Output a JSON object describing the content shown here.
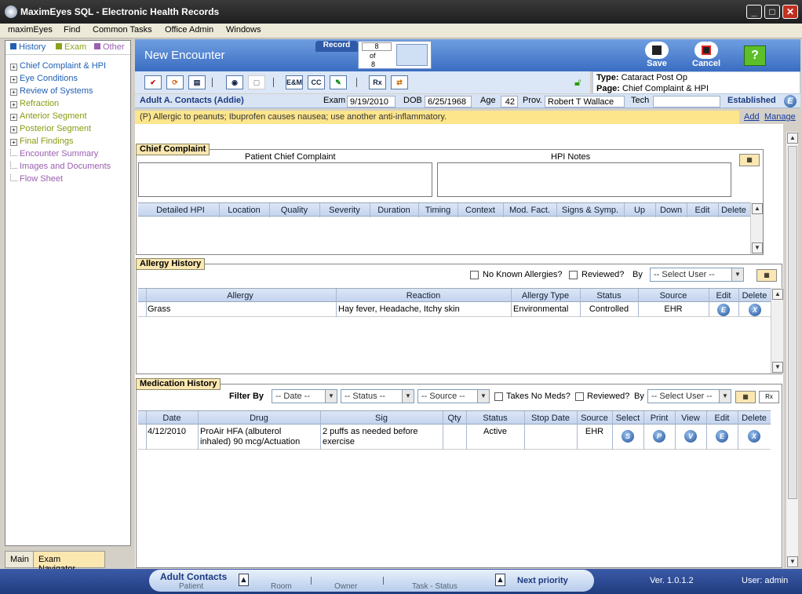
{
  "window": {
    "title": "MaximEyes SQL - Electronic Health Records"
  },
  "menu": [
    "maximEyes",
    "Find",
    "Common Tasks",
    "Office Admin",
    "Windows"
  ],
  "nav": {
    "legend": [
      {
        "label": "History",
        "color": "#1f5fb4"
      },
      {
        "label": "Exam",
        "color": "#8aa21a"
      },
      {
        "label": "Other",
        "color": "#9a5fb0"
      }
    ],
    "items": [
      {
        "label": "Chief Complaint & HPI",
        "color": "#1f5fb4"
      },
      {
        "label": "Eye Conditions",
        "color": "#1f5fb4"
      },
      {
        "label": "Review of Systems",
        "color": "#1f5fb4"
      },
      {
        "label": "Refraction",
        "color": "#8a9a10"
      },
      {
        "label": "Anterior Segment",
        "color": "#8a9a10"
      },
      {
        "label": "Posterior Segment",
        "color": "#8a9a10"
      },
      {
        "label": "Final Findings",
        "color": "#8a9a10"
      },
      {
        "label": "Encounter Summary",
        "color": "#9a5fb0"
      },
      {
        "label": "Images and Documents",
        "color": "#9a5fb0"
      },
      {
        "label": "Flow Sheet",
        "color": "#9a5fb0"
      }
    ],
    "tabs": {
      "main": "Main",
      "navigator": "Exam Navigator"
    }
  },
  "header": {
    "title": "New Encounter",
    "record_label": "Record",
    "record_current": "8",
    "record_of": "of",
    "record_total": "8",
    "save_label": "Save",
    "cancel_label": "Cancel"
  },
  "toolbar": {
    "em": "E&M",
    "cc": "CC",
    "rx": "Rx"
  },
  "type": {
    "type_label": "Type:",
    "type_value": "Cataract Post Op",
    "page_label": "Page:",
    "page_value": "Chief Complaint & HPI"
  },
  "patient": {
    "name": "Adult A. Contacts (Addie)",
    "exam_label": "Exam",
    "exam": "9/19/2010",
    "dob_label": "DOB",
    "dob": "6/25/1968",
    "age_label": "Age",
    "age": "42",
    "prov_label": "Prov.",
    "prov": "Robert T Wallace",
    "tech_label": "Tech",
    "tech": "",
    "status": "Established"
  },
  "alert": {
    "text": "(P) Allergic to peanuts; Ibuprofen causes nausea; use another anti-inflammatory.",
    "add": "Add",
    "manage": "Manage"
  },
  "chief": {
    "section_title": "Chief Complaint",
    "patient_label": "Patient Chief Complaint",
    "hpi_label": "HPI Notes",
    "columns": [
      "Detailed HPI",
      "Location",
      "Quality",
      "Severity",
      "Duration",
      "Timing",
      "Context",
      "Mod. Fact.",
      "Signs & Symp.",
      "Up",
      "Down",
      "Edit",
      "Delete"
    ]
  },
  "allergy": {
    "section_title": "Allergy History",
    "no_known": "No Known Allergies?",
    "reviewed": "Reviewed?",
    "by": "By",
    "select_user": "-- Select User --",
    "columns": [
      "Allergy",
      "Reaction",
      "Allergy Type",
      "Status",
      "Source",
      "Edit",
      "Delete"
    ],
    "rows": [
      {
        "allergy": "Grass",
        "reaction": "Hay fever, Headache, Itchy skin",
        "type": "Environmental",
        "status": "Controlled",
        "source": "EHR",
        "edit": "E",
        "delete": "X"
      }
    ]
  },
  "meds": {
    "section_title": "Medication History",
    "filter_by": "Filter By",
    "date": "-- Date --",
    "status": "-- Status --",
    "source": "-- Source --",
    "takes_no": "Takes No Meds?",
    "reviewed": "Reviewed?",
    "by": "By",
    "select_user": "-- Select User --",
    "columns": [
      "Date",
      "Drug",
      "Sig",
      "Qty",
      "Status",
      "Stop Date",
      "Source",
      "Select",
      "Print",
      "View",
      "Edit",
      "Delete"
    ],
    "rows": [
      {
        "date": "4/12/2010",
        "drug1": "ProAir HFA (albuterol",
        "drug2": "inhaled) 90 mcg/Actuation",
        "sig1": "2 puffs as needed before",
        "sig2": "exercise",
        "qty": "",
        "status": "Active",
        "stop": "",
        "source": "EHR",
        "select": "S",
        "print": "P",
        "view": "V",
        "edit": "E",
        "delete": "X"
      }
    ]
  },
  "statusbar": {
    "patient_name": "Adult Contacts",
    "patient_label": "Patient",
    "room_label": "Room",
    "owner_label": "Owner",
    "task_label": "Task - Status",
    "next": "Next priority",
    "version": "Ver. 1.0.1.2",
    "user": "User: admin"
  }
}
